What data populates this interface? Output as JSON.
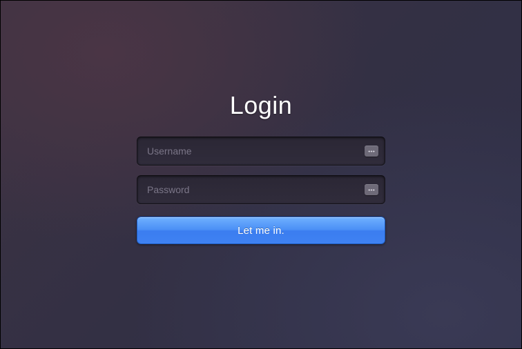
{
  "login": {
    "title": "Login",
    "username": {
      "placeholder": "Username",
      "value": ""
    },
    "password": {
      "placeholder": "Password",
      "value": ""
    },
    "submit_label": "Let me in.",
    "suffix_icon": "autofill-icon"
  },
  "colors": {
    "accent": "#4a8ff5",
    "input_bg": "#2e2a39",
    "placeholder": "#7b7688"
  }
}
